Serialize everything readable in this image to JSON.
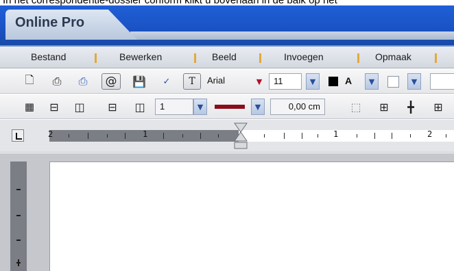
{
  "caption": "In het correspondentie-dossier conform klikt u bovenaan in de balk op het",
  "window": {
    "title": "Online Pro"
  },
  "menu": {
    "items": [
      {
        "label": "Bestand"
      },
      {
        "label": "Bewerken"
      },
      {
        "label": "Beeld"
      },
      {
        "label": "Invoegen"
      },
      {
        "label": "Opmaak"
      }
    ]
  },
  "toolbar1": {
    "font": "Arial",
    "font_size": "11",
    "text_color_label": "A",
    "icons": [
      "new-document-icon",
      "print-icon",
      "print-preview-icon",
      "email-icon",
      "save-icon",
      "spellcheck-icon",
      "font-icon"
    ]
  },
  "toolbar2": {
    "border_width": "1",
    "border_spacing": "0,00 cm",
    "icons": [
      "table-icon",
      "insert-row-icon",
      "insert-column-icon",
      "delete-row-icon",
      "delete-column-icon",
      "no-borders-icon",
      "all-borders-icon",
      "inner-borders-icon",
      "outer-borders-icon"
    ]
  },
  "ruler": {
    "labels_left": [
      "2",
      "1"
    ],
    "labels_right": [
      "1",
      "2"
    ]
  },
  "colors": {
    "titlebar": "#1f5fd6",
    "menu_separator": "#e3a93a",
    "dropdown_arrow_accent": "#b3122a"
  }
}
